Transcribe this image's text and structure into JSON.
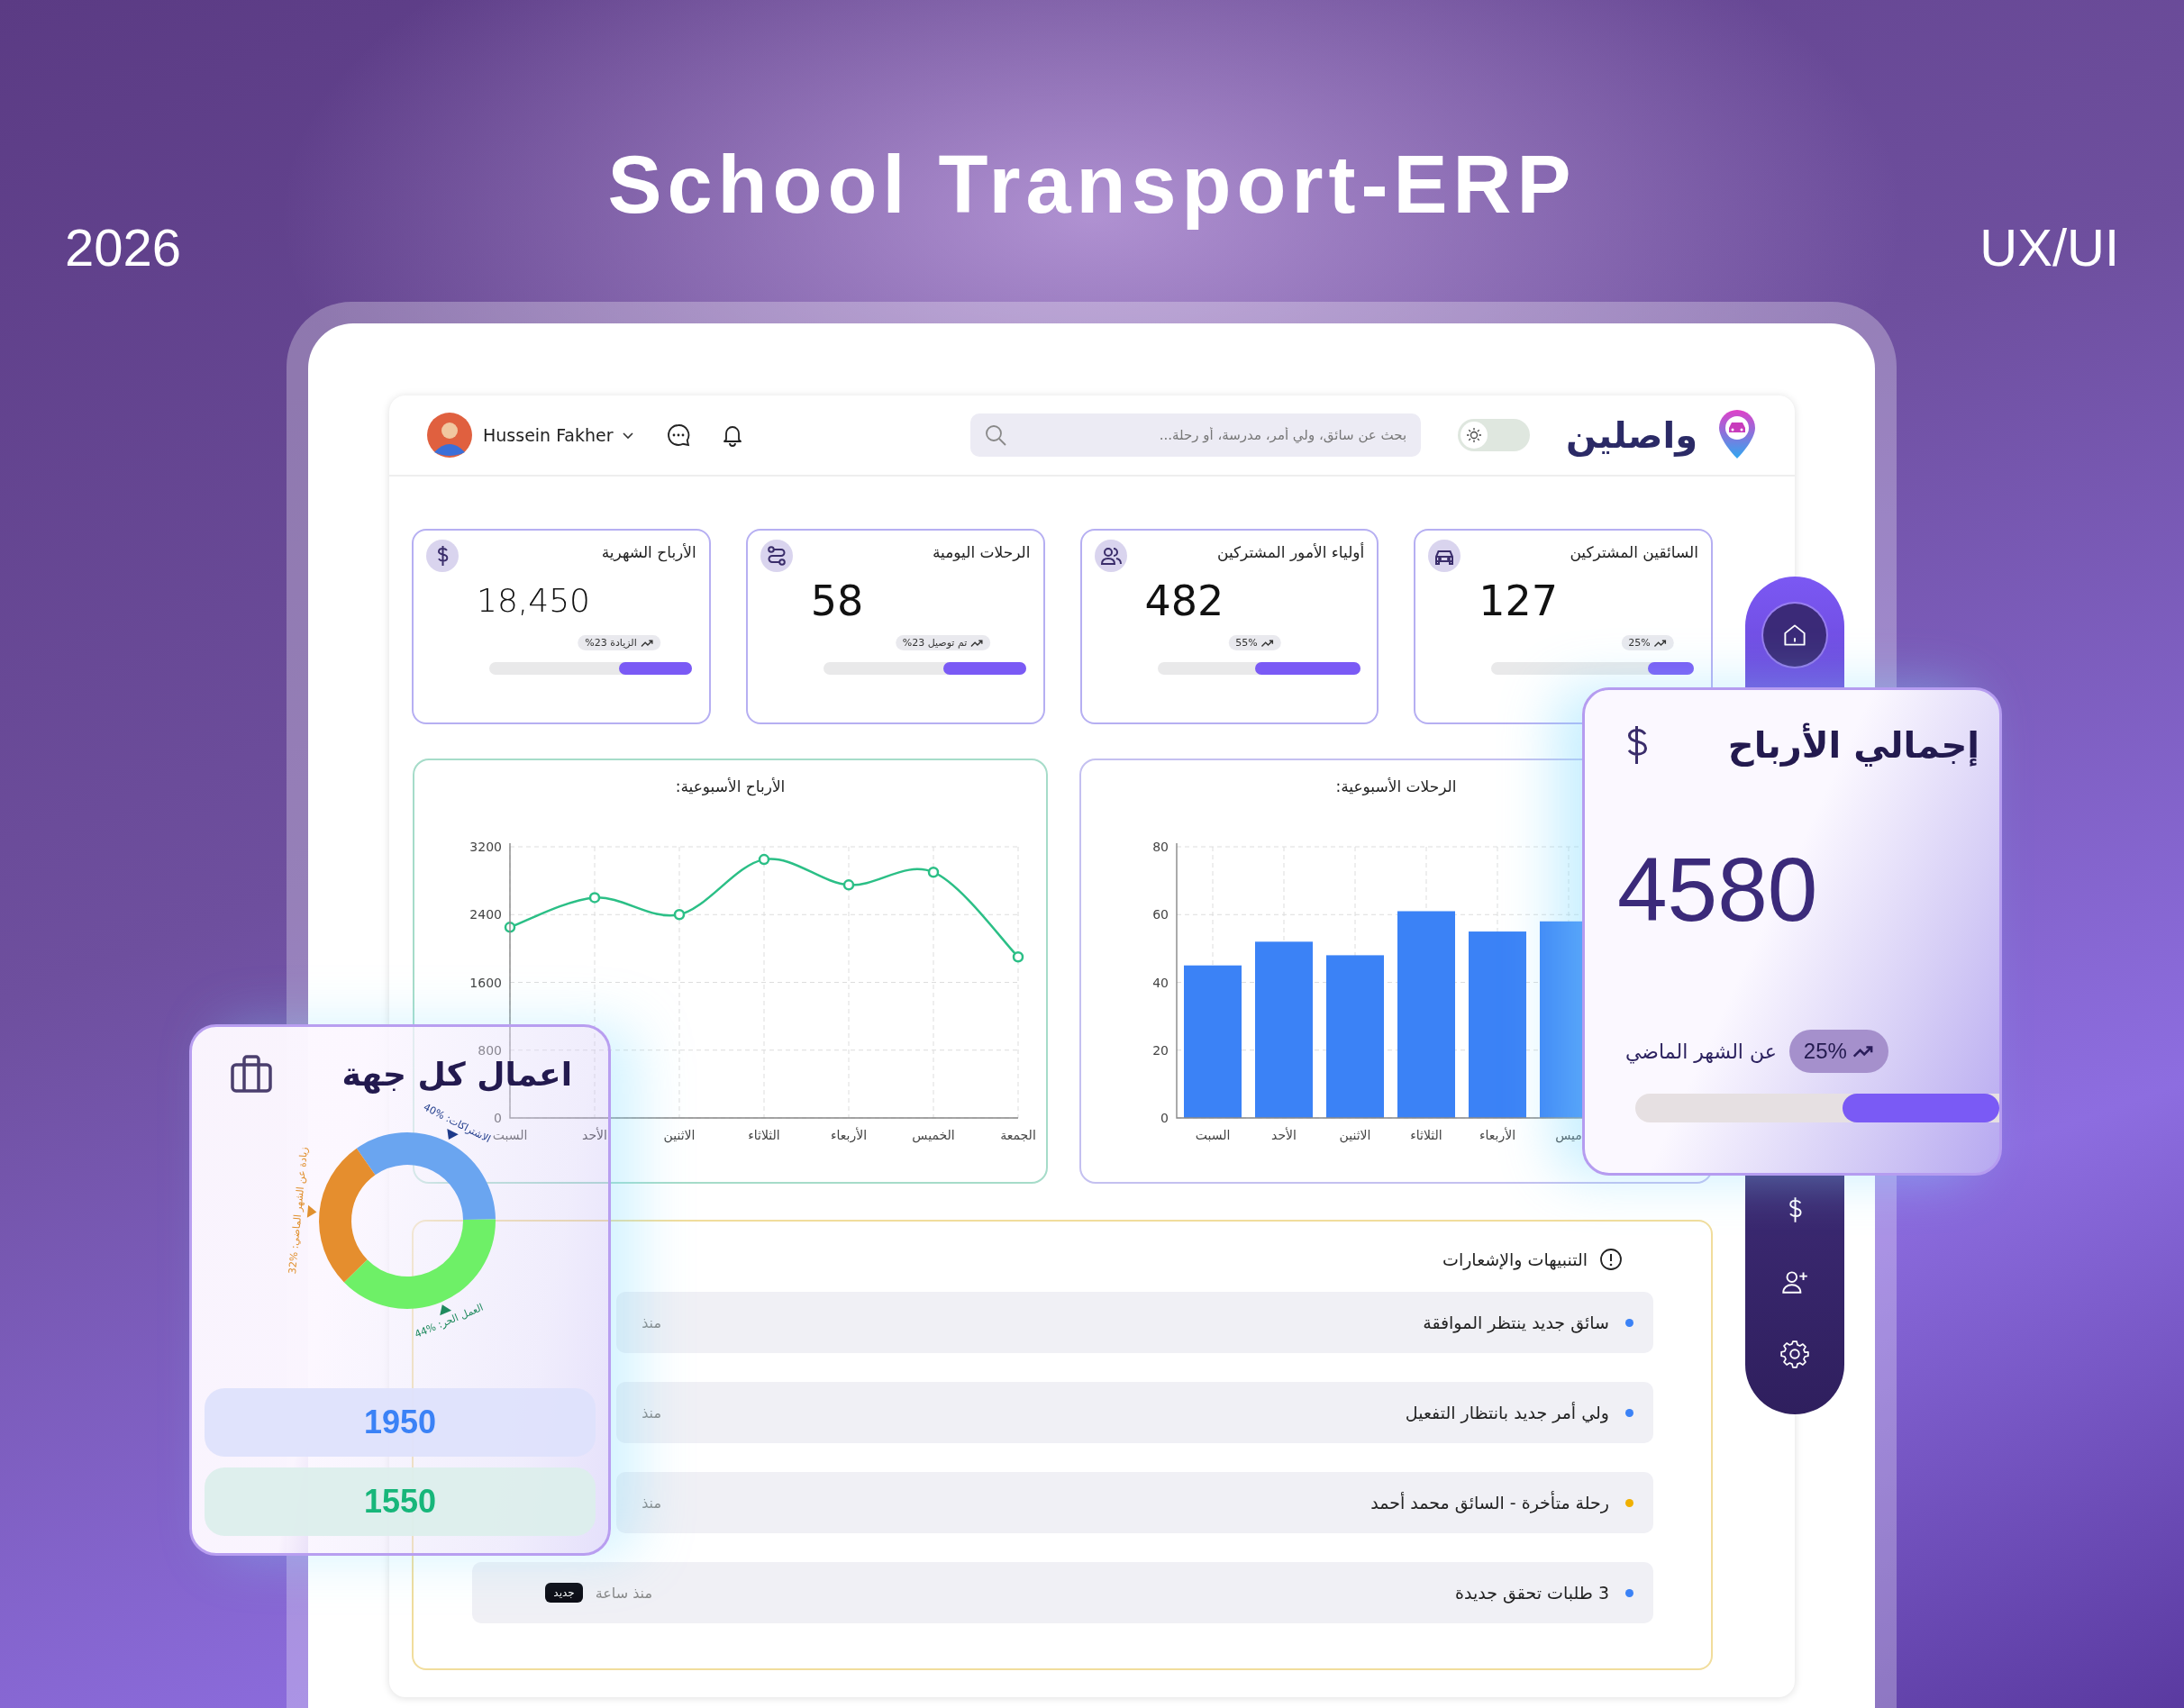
{
  "hero": {
    "year": "2026",
    "title": "School Transport-ERP",
    "tag": "UX/UI"
  },
  "header": {
    "user_name": "Hussein Fakher",
    "search": {
      "placeholder": "بحث عن سائق، ولي أمر، مدرسة، أو رحلة..."
    },
    "theme_toggle": {
      "on": false
    },
    "logo_text": "واصلين"
  },
  "stat_cards": [
    {
      "kind": "car",
      "title": "السائقين المشتركين",
      "value": "127",
      "badge": "25%",
      "level": 0.23
    },
    {
      "kind": "users",
      "title": "أولياء الأمور المشتركين",
      "value": "482",
      "badge": "55%",
      "level": 0.52
    },
    {
      "kind": "route",
      "title": "الرحلات اليومية",
      "value": "58",
      "badge": "%23 تم توصيل",
      "level": 0.41
    },
    {
      "kind": "dollar",
      "title": "الأرباح الشهرية",
      "value": "18,450",
      "badge": "%23 الزيادة",
      "level": 0.36
    }
  ],
  "charts": [
    {
      "title": "الرحلات الأسبوعية:",
      "chart_data": {
        "type": "bar",
        "categories": [
          "السبت",
          "الأحد",
          "الاثنين",
          "الثلاثاء",
          "الأربعاء",
          "ميس"
        ],
        "series": [
          {
            "color": "#3b82f6",
            "values": [
              45,
              52,
              48,
              61,
              55,
              58
            ]
          }
        ],
        "ylim": [
          0,
          80
        ],
        "yticks": [
          0,
          20,
          40,
          60,
          80
        ],
        "grid": true
      }
    },
    {
      "title": "الأرباح الأسبوعية:",
      "chart_data": {
        "type": "line",
        "categories": [
          "السبت",
          "الأحد",
          "الاثنين",
          "الثلاثاء",
          "الأربعاء",
          "الخميس",
          "الجمعة"
        ],
        "series": [
          {
            "color": "#2bbf86",
            "values": [
              2250,
              2600,
              2400,
              3050,
              2750,
              2900,
              1900
            ],
            "marker": "circle"
          }
        ],
        "ylim": [
          0,
          3200
        ],
        "yticks": [
          0,
          800,
          1600,
          2400,
          3200
        ],
        "grid": true
      }
    }
  ],
  "alerts": {
    "title": "التنبيهات والإشعارات",
    "items": [
      {
        "text": "سائق جديد ينتظر الموافقة",
        "color": "#3b82f6",
        "time": "منذ"
      },
      {
        "text": "ولي أمر جديد بانتظار التفعيل",
        "color": "#3b82f6",
        "time": "منذ"
      },
      {
        "text": "رحلة متأخرة - السائق محمد أحمد",
        "color": "#f0b000",
        "time": "منذ"
      },
      {
        "text": "3 طلبات تحقق جديدة",
        "color": "#3b82f6",
        "time": "منذ ساعة",
        "badge": "جديد"
      }
    ]
  },
  "sidebar": {
    "items": [
      {
        "kind": "home",
        "selected": true
      },
      {
        "kind": "dollar",
        "selected": false
      },
      {
        "kind": "add-user",
        "selected": false
      },
      {
        "kind": "settings",
        "selected": false
      }
    ]
  },
  "earnings_card": {
    "title": "إجمالي الأرباح",
    "value": "4580",
    "caption": "عن الشهر الماضي",
    "change": "25%",
    "level": 0.43
  },
  "sector_card": {
    "title": "اعمال كل جهة",
    "chart_data": {
      "type": "donut",
      "values": [
        40,
        44,
        32
      ],
      "value_labels": [
        "الاشتراكات: %40",
        "العمل الحر: %44",
        "زيادة عن الشهر الماضي: %32"
      ]
    },
    "totals": [
      "1950",
      "1550"
    ]
  }
}
